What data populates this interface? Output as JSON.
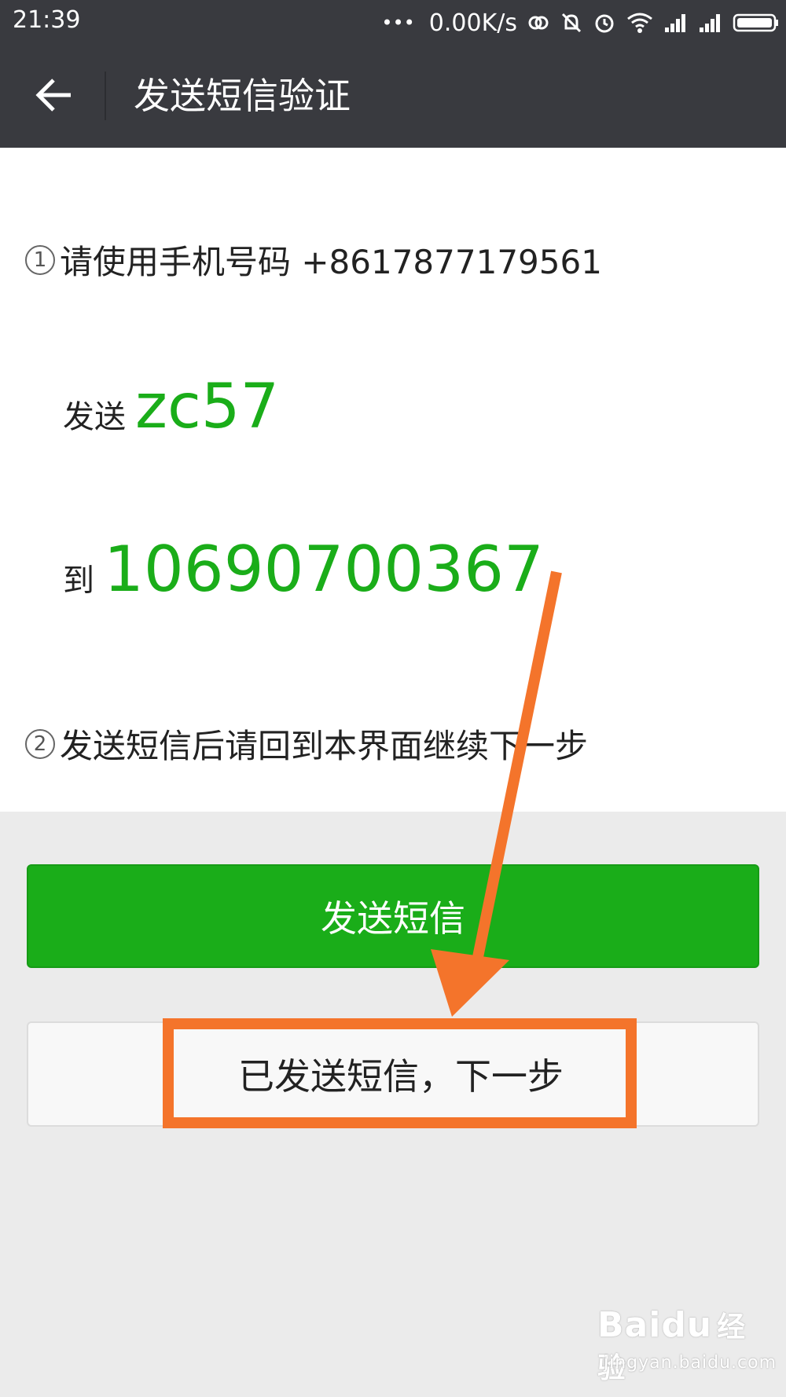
{
  "status_bar": {
    "time": "21:39",
    "dots": "•••",
    "network_speed": "0.00K/s",
    "icons": [
      "link-icon",
      "mute-icon",
      "alarm-icon",
      "wifi-icon",
      "signal-icon",
      "signal-icon",
      "battery-icon"
    ]
  },
  "app_bar": {
    "back_icon": "arrow-left-icon",
    "title": "发送短信验证"
  },
  "instructions": {
    "step1_number": "1",
    "step1_text": "请使用手机号码 +8617877179561",
    "send_label": "发送",
    "code": "zc57",
    "to_label": "到",
    "target_number": "10690700367",
    "step2_number": "2",
    "step2_text": "发送短信后请回到本界面继续下一步"
  },
  "buttons": {
    "send_sms": "发送短信",
    "sent_next": "已发送短信，下一步"
  },
  "annotation": {
    "arrow_color": "#f4742b",
    "highlight_color": "#f4742b"
  },
  "colors": {
    "header_bg": "#393a3f",
    "accent_green": "#1aad19",
    "page_bg": "#ebebeb"
  },
  "watermark": {
    "logo": "Bai",
    "logo_tail": "du",
    "logo_suffix": "经验",
    "url": "jingyan.baidu.com"
  }
}
